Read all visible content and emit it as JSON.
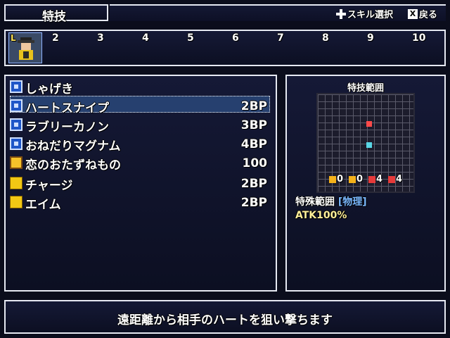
{
  "header": {
    "title": "特技",
    "hint_skill": "スキル選択",
    "hint_back": "戻る",
    "back_key": "X"
  },
  "party": {
    "lead_mark": "L",
    "slots": [
      "2",
      "3",
      "4",
      "5",
      "6",
      "7",
      "8",
      "9",
      "10"
    ]
  },
  "skills": [
    {
      "name": "しゃげき",
      "cost": "",
      "icon": "blue-square-icon"
    },
    {
      "name": "ハートスナイプ",
      "cost": "2BP",
      "icon": "blue-square-icon"
    },
    {
      "name": "ラブリーカノン",
      "cost": "3BP",
      "icon": "blue-square-icon"
    },
    {
      "name": "おねだりマグナム",
      "cost": "4BP",
      "icon": "blue-square-icon"
    },
    {
      "name": "恋のおたずねもの",
      "cost": "100",
      "icon": "gold-special-icon"
    },
    {
      "name": "チャージ",
      "cost": "2BP",
      "icon": "yellow-support-icon"
    },
    {
      "name": "エイム",
      "cost": "2BP",
      "icon": "yellow-support-icon"
    }
  ],
  "range": {
    "title": "特技範囲",
    "stats": [
      "0",
      "0",
      "4",
      "4"
    ],
    "special_prefix": "特殊範囲",
    "special_tag": "[物理]",
    "atk": "ATK100%"
  },
  "description": "遠距離から相手のハートを狙い撃ちます",
  "colors": {
    "frame": "#e6e9f2",
    "panel": "#151936",
    "cursor": "#26406f",
    "target_cell": "#ff4a4a",
    "origin_cell": "#59d6e6",
    "physical_tag": "#7ab8ff"
  }
}
